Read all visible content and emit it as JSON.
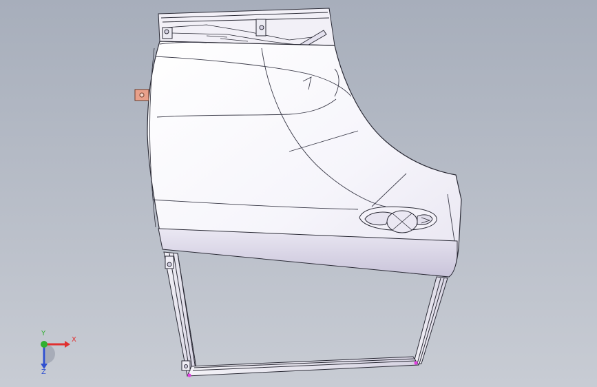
{
  "viewport": {
    "background_top": "#a7aebb",
    "background_bottom": "#c8ccd4"
  },
  "model": {
    "colors": {
      "fill": "#fbfbfe",
      "fill_shade": "#e6e4f0",
      "fill_lower": "#dcd8ea",
      "edge": "#2a2a35",
      "thin_edge": "#4a4a58",
      "hinge_clip": "#e8a08a",
      "corner_marker": "#e040e0"
    }
  },
  "triad": {
    "x_label": "X",
    "y_label": "Y",
    "z_label": "Z",
    "x_color": "#e03030",
    "y_color": "#30b030",
    "z_color": "#3050d0"
  }
}
